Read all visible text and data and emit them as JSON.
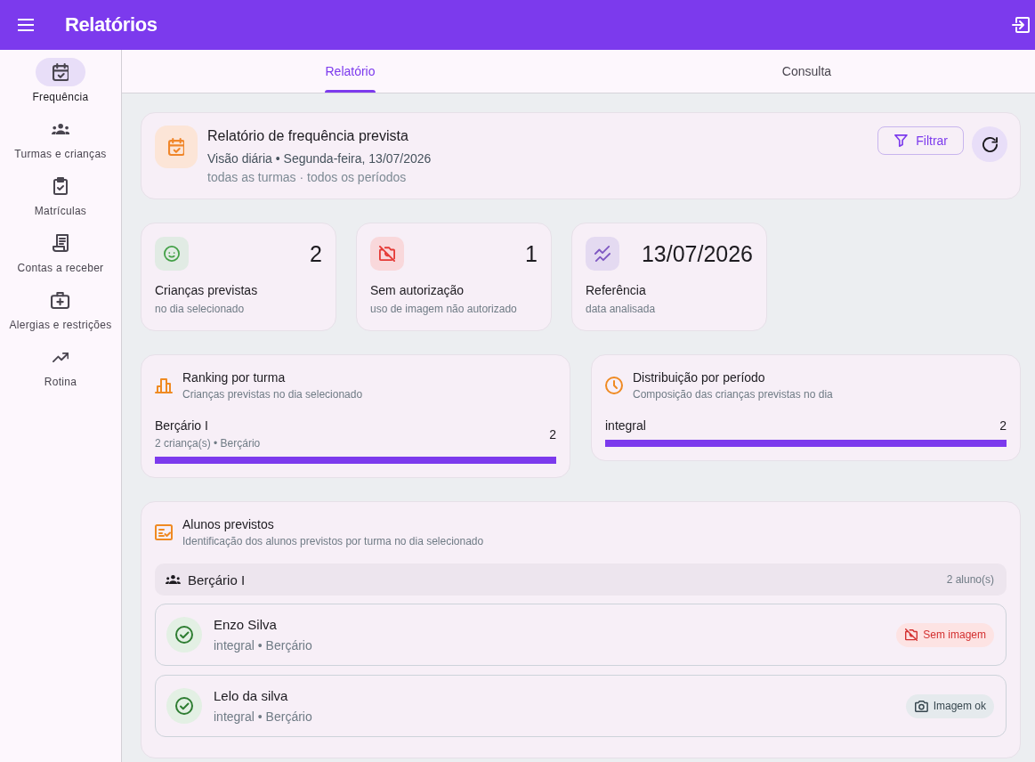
{
  "app_bar": {
    "title": "Relatórios"
  },
  "sidebar": {
    "items": [
      {
        "label": "Frequência",
        "selected": true
      },
      {
        "label": "Turmas e crianças",
        "selected": false
      },
      {
        "label": "Matrículas",
        "selected": false
      },
      {
        "label": "Contas a receber",
        "selected": false
      },
      {
        "label": "Alergias e restrições",
        "selected": false
      },
      {
        "label": "Rotina",
        "selected": false
      }
    ]
  },
  "tabs": [
    {
      "label": "Relatório",
      "selected": true
    },
    {
      "label": "Consulta",
      "selected": false
    }
  ],
  "report_header": {
    "title": "Relatório de frequência prevista",
    "subtitle": "Visão diária • Segunda-feira, 13/07/2026",
    "scope": "todas as turmas · todos os períodos",
    "filter_button": "Filtrar"
  },
  "stats": [
    {
      "value": "2",
      "label": "Crianças previstas",
      "caption": "no dia selecionado"
    },
    {
      "value": "1",
      "label": "Sem autorização",
      "caption": "uso de imagem não autorizado"
    },
    {
      "value": "13/07/2026",
      "label": "Referência",
      "caption": "data analisada"
    }
  ],
  "ranking": {
    "title": "Ranking por turma",
    "subtitle": "Crianças previstas no dia selecionado",
    "rows": [
      {
        "name": "Berçário I",
        "detail": "2 criança(s) • Berçário",
        "value": "2",
        "level": 1
      }
    ]
  },
  "distribution": {
    "title": "Distribuição por período",
    "subtitle": "Composição das crianças previstas no dia",
    "rows": [
      {
        "name": "integral",
        "value": "2",
        "level": 1
      }
    ]
  },
  "students": {
    "title": "Alunos previstos",
    "subtitle": "Identificação dos alunos previstos por turma no dia selecionado",
    "groups": [
      {
        "name": "Berçário I",
        "count": "2 aluno(s)",
        "students": [
          {
            "name": "Enzo Silva",
            "detail": "integral • Berçário",
            "image_badge": "Sem imagem",
            "image_authorized": false
          },
          {
            "name": "Lelo da silva",
            "detail": "integral • Berçário",
            "image_badge": "Imagem ok",
            "image_authorized": true
          }
        ]
      }
    ]
  }
}
